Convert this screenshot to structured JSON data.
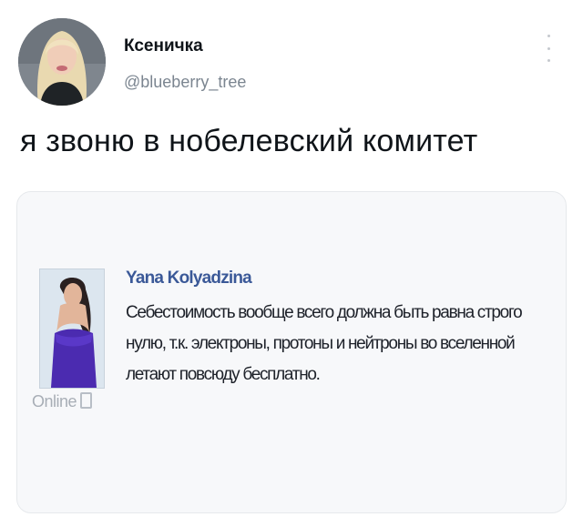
{
  "tweet": {
    "author_name": "Ксеничка",
    "author_handle": "@blueberry_tree",
    "text": "я звоню в нобелевский комитет",
    "more_icon": "more-vertical-icon"
  },
  "embedded_post": {
    "author_name": "Yana Kolyadzina",
    "status": "Online",
    "status_icon": "mobile-phone-icon",
    "lines": [
      "Себестоимость вообще всего должна быть равна строго",
      "нулю, т.к. электроны, протоны и нейтроны во вселенной",
      "летают повсюду бесплатно."
    ]
  }
}
